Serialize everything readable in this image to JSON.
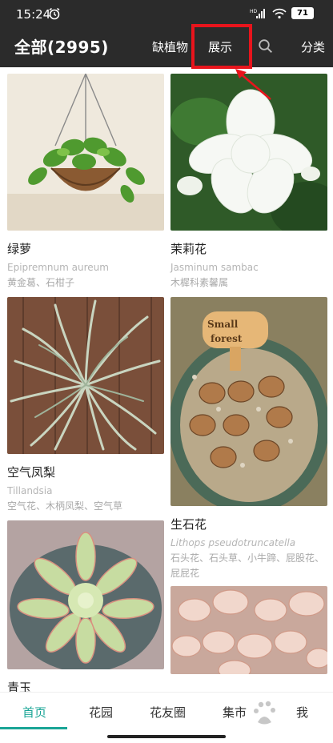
{
  "statusbar": {
    "time": "15:24",
    "battery": "71",
    "icons": [
      "alarm-icon",
      "hd-signal-icon",
      "wifi-icon",
      "battery-icon"
    ]
  },
  "appbar": {
    "title": "全部(2995)",
    "menu": [
      "缺植物",
      "展示",
      "search-icon",
      "分类"
    ],
    "annotation_color": "#e8141c"
  },
  "plants": [
    {
      "name": "绿萝",
      "latin": "Epipremnum aureum",
      "alias": "黄金葛、石柑子"
    },
    {
      "name": "茉莉花",
      "latin": "Jasminum sambac",
      "alias": "木樨科素馨属"
    },
    {
      "name": "空气凤梨",
      "latin": "Tillandsia",
      "alias": "空气花、木柄凤梨、空气草"
    },
    {
      "name": "生石花",
      "latin": "Lithops pseudotruncatella",
      "alias": "石头花、石头草、小牛蹄、屁股花、屁屁花"
    },
    {
      "name": "青玉",
      "latin": "",
      "alias": ""
    },
    {
      "name": "",
      "latin": "",
      "alias": ""
    }
  ],
  "tabs": [
    {
      "label": "首页",
      "active": true
    },
    {
      "label": "花园",
      "active": false
    },
    {
      "label": "花友圈",
      "active": false
    },
    {
      "label": "集市",
      "active": false
    },
    {
      "label": "我",
      "active": false
    }
  ],
  "colors": {
    "accent": "#1aa596",
    "appbar": "#2b2b2b"
  }
}
